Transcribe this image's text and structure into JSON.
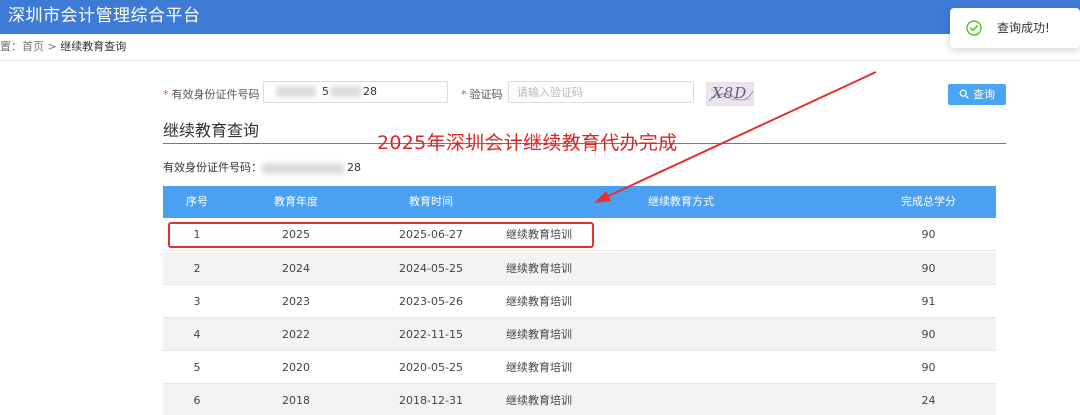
{
  "header": {
    "title": "深圳市会计管理综合平台"
  },
  "breadcrumb": {
    "prefix": "置：",
    "home": "首页",
    "separator": " > ",
    "current": "继续教育查询"
  },
  "toast": {
    "message": "查询成功!",
    "icon": "check-circle-icon",
    "color": "#52c41a"
  },
  "form": {
    "id_label": "有效身份证件号码",
    "id_value_tail_1": "5",
    "id_value_tail_2": "28",
    "captcha_label": "验证码",
    "captcha_placeholder": "请输入验证码",
    "captcha_image_text": "X8D",
    "query_button": "查询"
  },
  "section": {
    "title": "继续教育查询",
    "id_line_label": "有效身份证件号码：",
    "id_line_tail": "28"
  },
  "annotation": {
    "caption": "2025年深圳会计继续教育代办完成",
    "color": "#e02424"
  },
  "table": {
    "headers": [
      "序号",
      "教育年度",
      "教育时间",
      "继续教育方式",
      "完成总学分"
    ],
    "rows": [
      {
        "no": "1",
        "year": "2025",
        "date": "2025-06-27",
        "method": "继续教育培训",
        "credits": "90"
      },
      {
        "no": "2",
        "year": "2024",
        "date": "2024-05-25",
        "method": "继续教育培训",
        "credits": "90"
      },
      {
        "no": "3",
        "year": "2023",
        "date": "2023-05-26",
        "method": "继续教育培训",
        "credits": "91"
      },
      {
        "no": "4",
        "year": "2022",
        "date": "2022-11-15",
        "method": "继续教育培训",
        "credits": "90"
      },
      {
        "no": "5",
        "year": "2020",
        "date": "2020-05-25",
        "method": "继续教育培训",
        "credits": "90"
      },
      {
        "no": "6",
        "year": "2018",
        "date": "2018-12-31",
        "method": "继续教育培训",
        "credits": "24"
      }
    ]
  },
  "colors": {
    "header_bg": "#3e7bd6",
    "table_header_bg": "#4ba0f1",
    "button_bg": "#48a5f2",
    "required_star": "#e14d4d"
  }
}
